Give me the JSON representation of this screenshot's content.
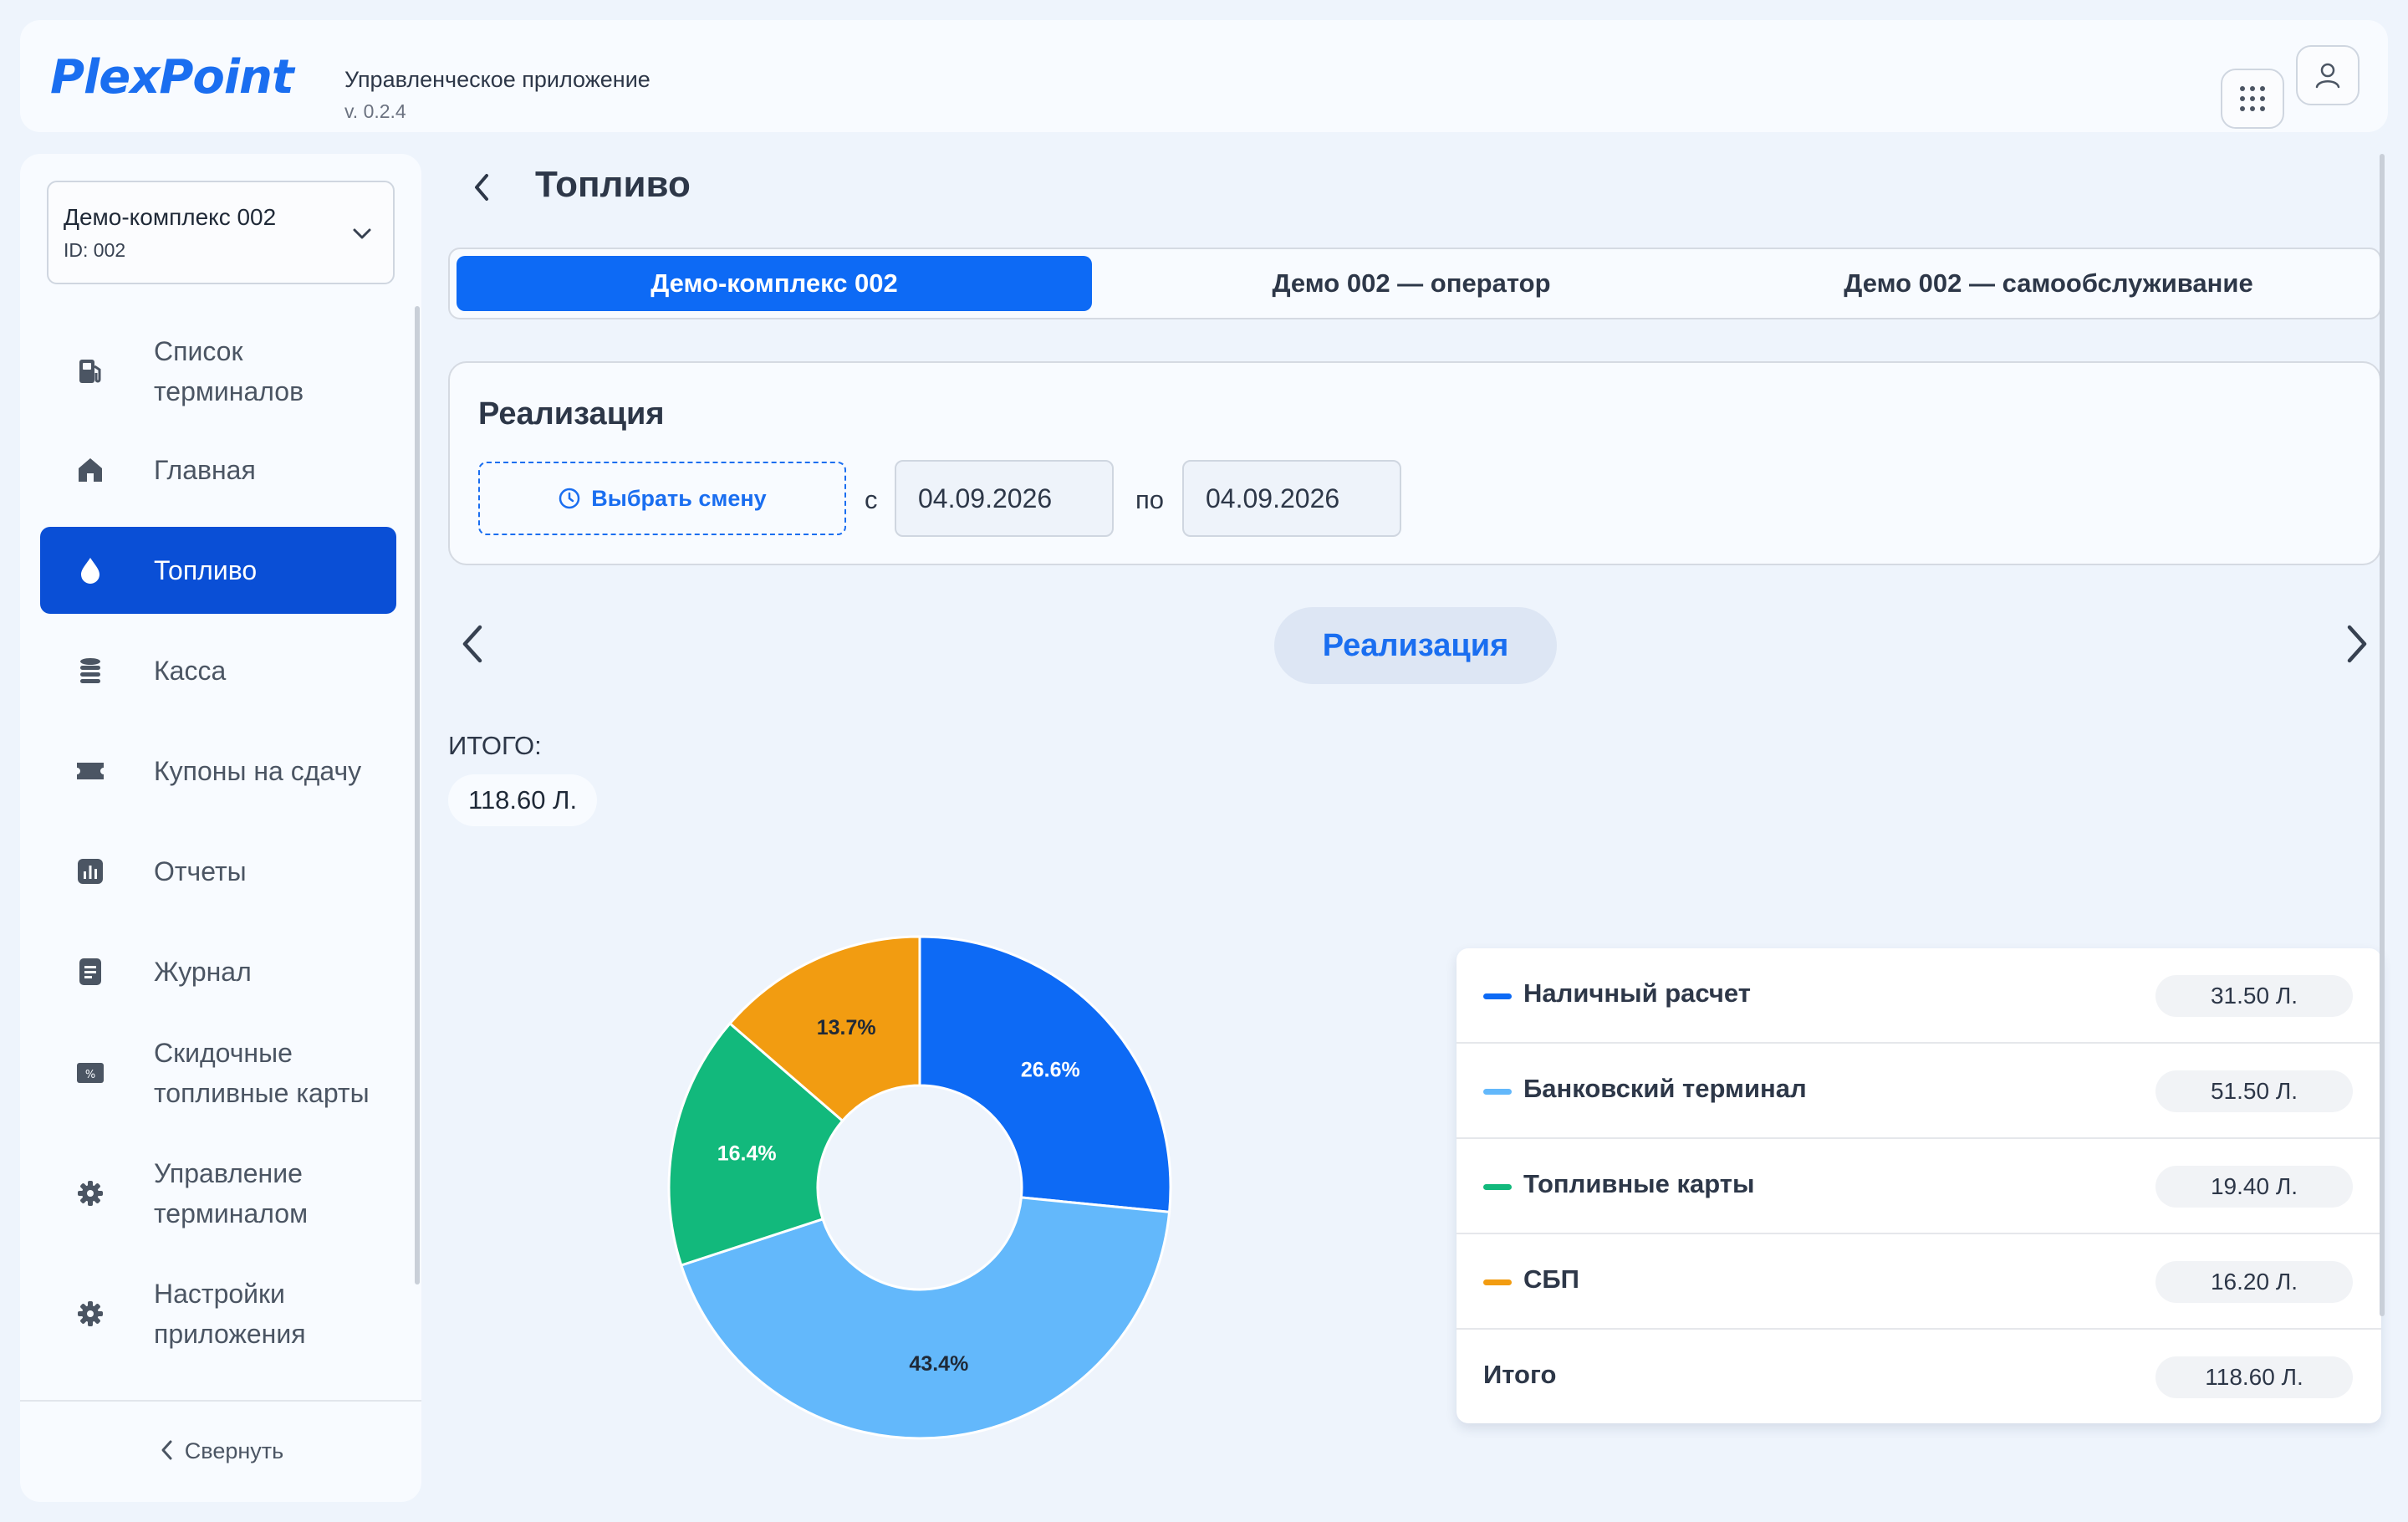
{
  "header": {
    "logo_text": "PlexPoint",
    "app_title": "Управленческое приложение",
    "app_version": "v. 0.2.4",
    "apps_icon": "grid-icon",
    "profile_icon": "user-icon"
  },
  "sidebar": {
    "station": {
      "name": "Демо-комплекс 002",
      "id": "ID: 002"
    },
    "items": [
      {
        "label": "Список терминалов",
        "icon": "fuel-pump-icon"
      },
      {
        "label": "Главная",
        "icon": "home-icon"
      },
      {
        "label": "Топливо",
        "icon": "drop-icon",
        "active": true
      },
      {
        "label": "Касса",
        "icon": "coins-icon"
      },
      {
        "label": "Купоны на сдачу",
        "icon": "ticket-icon"
      },
      {
        "label": "Отчеты",
        "icon": "chart-icon"
      },
      {
        "label": "Журнал",
        "icon": "document-icon"
      },
      {
        "label": "Скидочные топливные карты",
        "icon": "discount-card-icon"
      },
      {
        "label": "Управление терминалом",
        "icon": "gear-icon"
      },
      {
        "label": "Настройки приложения",
        "icon": "gear-icon"
      }
    ],
    "collapse_label": "Свернуть"
  },
  "main": {
    "title": "Топливо",
    "tabs": [
      "Демо-комплекс 002",
      "Демо 002 — оператор",
      "Демо 002 — самообслуживание"
    ],
    "active_tab": 0,
    "card": {
      "title": "Реализация",
      "shift_button": "Выбрать смену",
      "from_label": "с",
      "from_date": "04.09.2026",
      "to_label": "по",
      "to_date": "04.09.2026"
    },
    "mode_label": "Реализация",
    "total_label": "ИТОГО:",
    "total_value": "118.60 Л."
  },
  "colors": {
    "accent": "#0d6af5",
    "sidebar_active": "#0a4fd6",
    "cash": "#0d6af5",
    "bank": "#63b8fb",
    "fuel_cards": "#12b97c",
    "sbp": "#f29c11"
  },
  "chart_data": {
    "type": "pie",
    "donut": true,
    "categories": [
      "Наличный расчет",
      "Банковский терминал",
      "Топливные карты",
      "СБП"
    ],
    "values": [
      31.5,
      51.5,
      19.4,
      16.2
    ],
    "percent_labels": [
      "26.6%",
      "43.4%",
      "16.4%",
      "13.7%"
    ],
    "colors": [
      "#0d6af5",
      "#63b8fb",
      "#12b97c",
      "#f29c11"
    ]
  },
  "legend": {
    "rows": [
      {
        "label": "Наличный расчет",
        "value": "31.50 Л.",
        "color": "#0d6af5"
      },
      {
        "label": "Банковский терминал",
        "value": "51.50 Л.",
        "color": "#63b8fb"
      },
      {
        "label": "Топливные карты",
        "value": "19.40 Л.",
        "color": "#12b97c"
      },
      {
        "label": "СБП",
        "value": "16.20 Л.",
        "color": "#f29c11"
      }
    ],
    "total_label": "Итого",
    "total_value": "118.60 Л."
  }
}
